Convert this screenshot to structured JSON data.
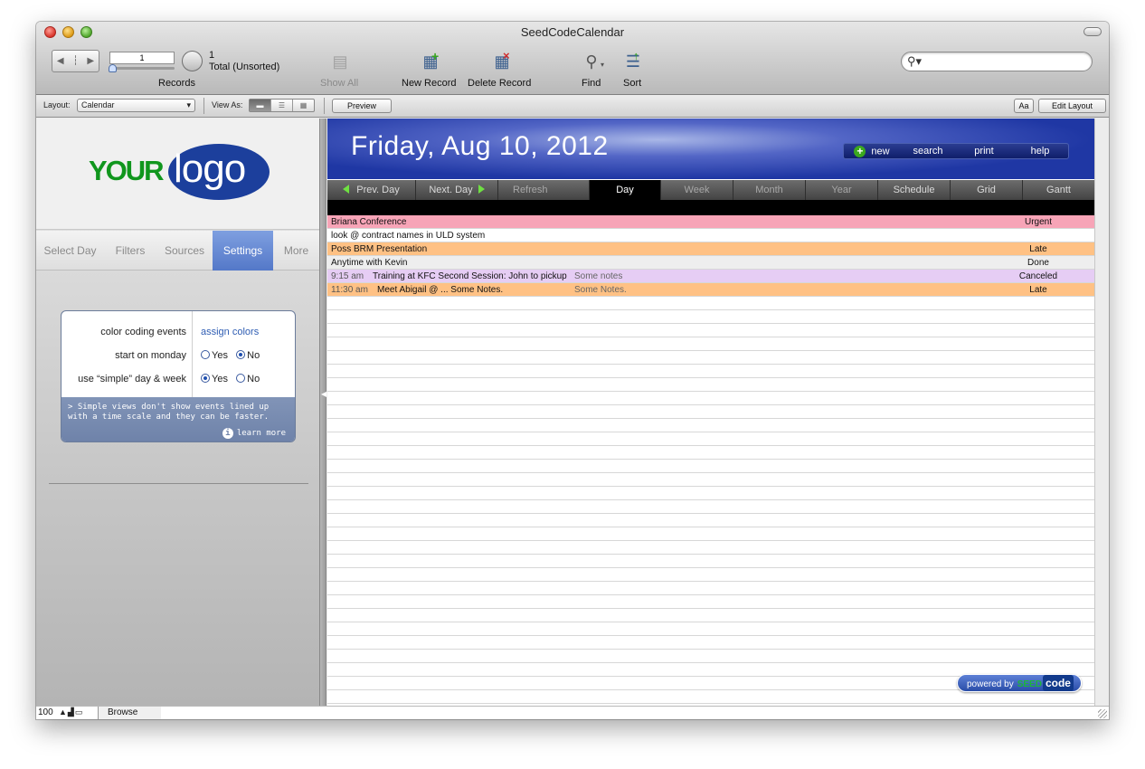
{
  "window": {
    "title": "SeedCodeCalendar"
  },
  "toolbar": {
    "record_current": "1",
    "record_total": "1",
    "record_sort": "Total (Unsorted)",
    "records_label": "Records",
    "show_all": "Show All",
    "new_record": "New Record",
    "delete_record": "Delete Record",
    "find": "Find",
    "sort": "Sort",
    "search_placeholder": ""
  },
  "layoutbar": {
    "layout_label": "Layout:",
    "layout_value": "Calendar",
    "view_as_label": "View As:",
    "preview": "Preview",
    "aa": "Aa",
    "edit_layout": "Edit Layout"
  },
  "left": {
    "logo_your": "YOUR",
    "logo_logo": "logo",
    "tabs": [
      "Select Day",
      "Filters",
      "Sources",
      "Settings",
      "More"
    ],
    "active_tab": "Settings",
    "settings": {
      "color_label": "color coding events",
      "color_link": "assign colors",
      "monday_label": "start on monday",
      "simple_label": "use “simple” day & week",
      "yes": "Yes",
      "no": "No",
      "note": "> Simple views don't show events lined up with a time scale and they can be faster.",
      "learn_more": "learn more"
    }
  },
  "main": {
    "date": "Friday, Aug 10, 2012",
    "actions": [
      "new",
      "search",
      "print",
      "help"
    ],
    "nav": {
      "prev": "Prev. Day",
      "next": "Next. Day",
      "refresh": "Refresh",
      "views": [
        "Day",
        "Week",
        "Month",
        "Year",
        "Schedule",
        "Grid",
        "Gantt"
      ],
      "active": "Day"
    },
    "events": [
      {
        "time": "",
        "title": "Briana Conference",
        "notes": "",
        "status": "Urgent",
        "color": "#f7a4b7"
      },
      {
        "time": "",
        "title": "look @ contract names in ULD system",
        "notes": "",
        "status": "",
        "color": "#ffffff"
      },
      {
        "time": "",
        "title": "Poss BRM Presentation",
        "notes": "",
        "status": "Late",
        "color": "#ffc184"
      },
      {
        "time": "",
        "title": "Anytime with Kevin",
        "notes": "",
        "status": "Done",
        "color": "#eeeeee"
      },
      {
        "time": "9:15 am",
        "title": "Training at KFC Second Session: John to pickup",
        "notes": "Some notes",
        "status": "Canceled",
        "color": "#e6cdf4"
      },
      {
        "time": "11:30 am",
        "title": "Meet Abigail @ ... Some Notes.",
        "notes": "Some Notes.",
        "status": "Late",
        "color": "#ffc184"
      }
    ],
    "powered_by": "powered by",
    "seed": "SEED",
    "code": "code"
  },
  "status": {
    "zoom": "100",
    "mode": "Browse"
  }
}
